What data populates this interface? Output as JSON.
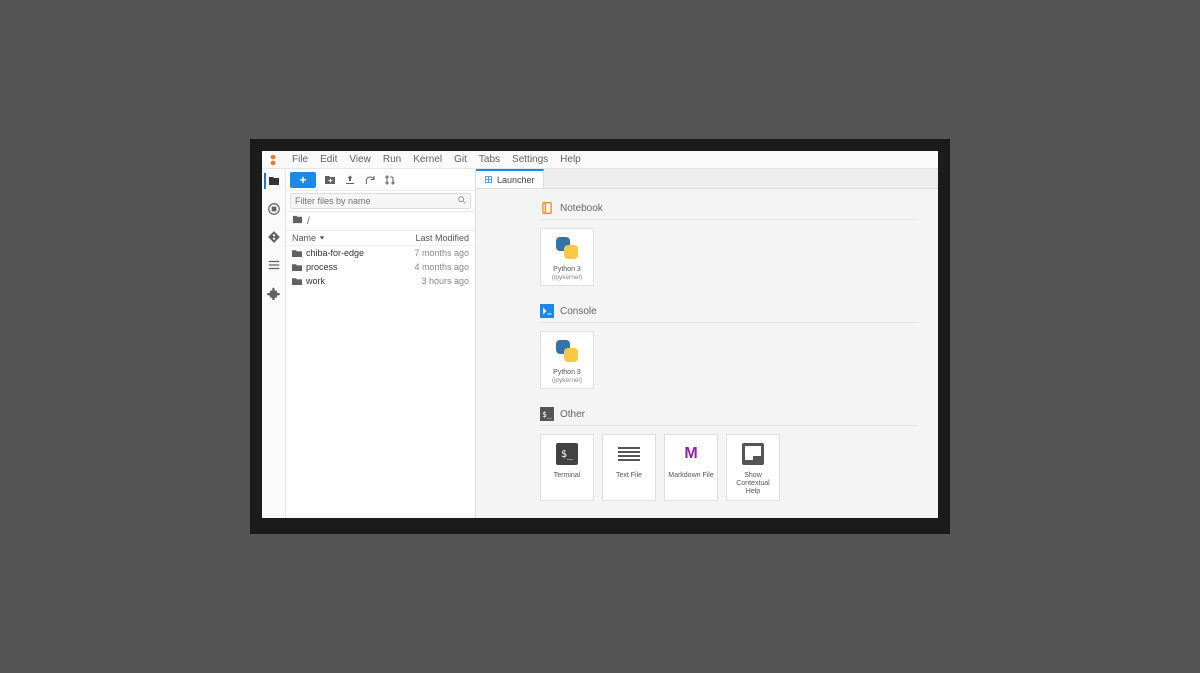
{
  "menu": {
    "items": [
      "File",
      "Edit",
      "View",
      "Run",
      "Kernel",
      "Git",
      "Tabs",
      "Settings",
      "Help"
    ]
  },
  "filebrowser": {
    "new_button": "+",
    "filter_placeholder": "Filter files by name",
    "breadcrumb_root": "/",
    "header_name": "Name",
    "header_modified": "Last Modified",
    "rows": [
      {
        "name": "chiba-for-edge",
        "modified": "7 months ago"
      },
      {
        "name": "process",
        "modified": "4 months ago"
      },
      {
        "name": "work",
        "modified": "3 hours ago"
      }
    ]
  },
  "tabs": [
    {
      "label": "Launcher"
    }
  ],
  "launcher": {
    "sections": [
      {
        "title": "Notebook",
        "icon": "notebook",
        "cards": [
          {
            "icon": "python",
            "label": "Python 3",
            "sub": "(ipykernel)"
          }
        ]
      },
      {
        "title": "Console",
        "icon": "console",
        "cards": [
          {
            "icon": "python",
            "label": "Python 3",
            "sub": "(ipykernel)"
          }
        ]
      },
      {
        "title": "Other",
        "icon": "terminal",
        "cards": [
          {
            "icon": "terminal",
            "label": "Terminal",
            "sub": ""
          },
          {
            "icon": "text",
            "label": "Text File",
            "sub": ""
          },
          {
            "icon": "markdown",
            "label": "Markdown File",
            "sub": ""
          },
          {
            "icon": "help",
            "label": "Show Contextual Help",
            "sub": ""
          }
        ]
      }
    ]
  }
}
